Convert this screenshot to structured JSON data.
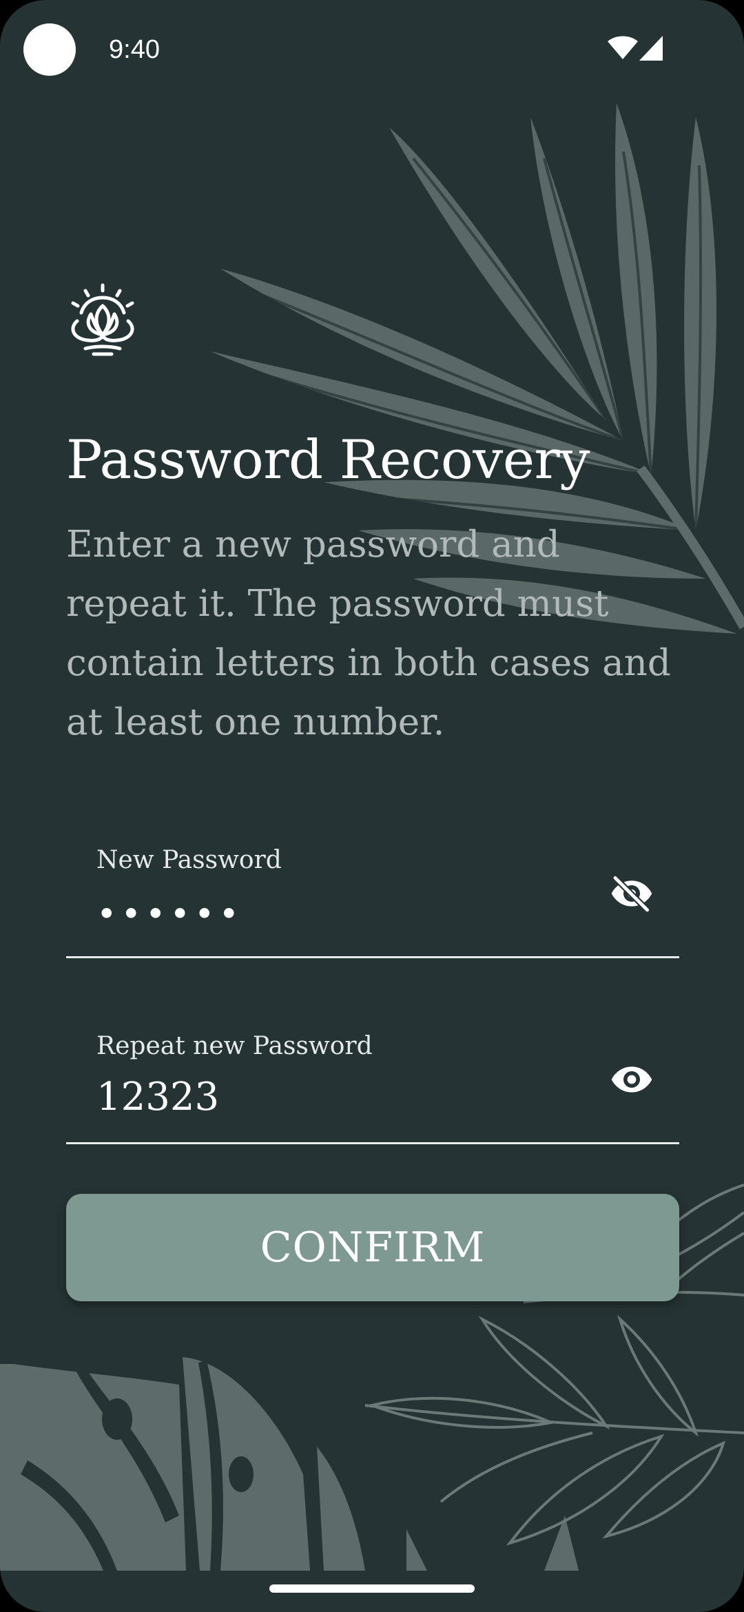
{
  "status_bar": {
    "time": "9:40",
    "icons": [
      "camera-dot",
      "wifi-icon",
      "signal-icon"
    ]
  },
  "logo": {
    "icon": "lotus-sun-icon"
  },
  "header": {
    "title": "Password Recovery",
    "description": "Enter a new password and repeat it. The password must contain letters in both cases and at least one number."
  },
  "form": {
    "new_password": {
      "label": "New Password",
      "value": "••••••",
      "visibility_icon": "eye-off-icon"
    },
    "repeat_password": {
      "label": "Repeat new Password",
      "value": "12323",
      "visibility_icon": "eye-icon"
    },
    "confirm_label": "CONFIRM"
  },
  "colors": {
    "background": "#263334",
    "button": "#7d9992",
    "text_primary": "#ffffff",
    "text_secondary": "#b2b9ba",
    "leaf": "#5d6b6b"
  }
}
